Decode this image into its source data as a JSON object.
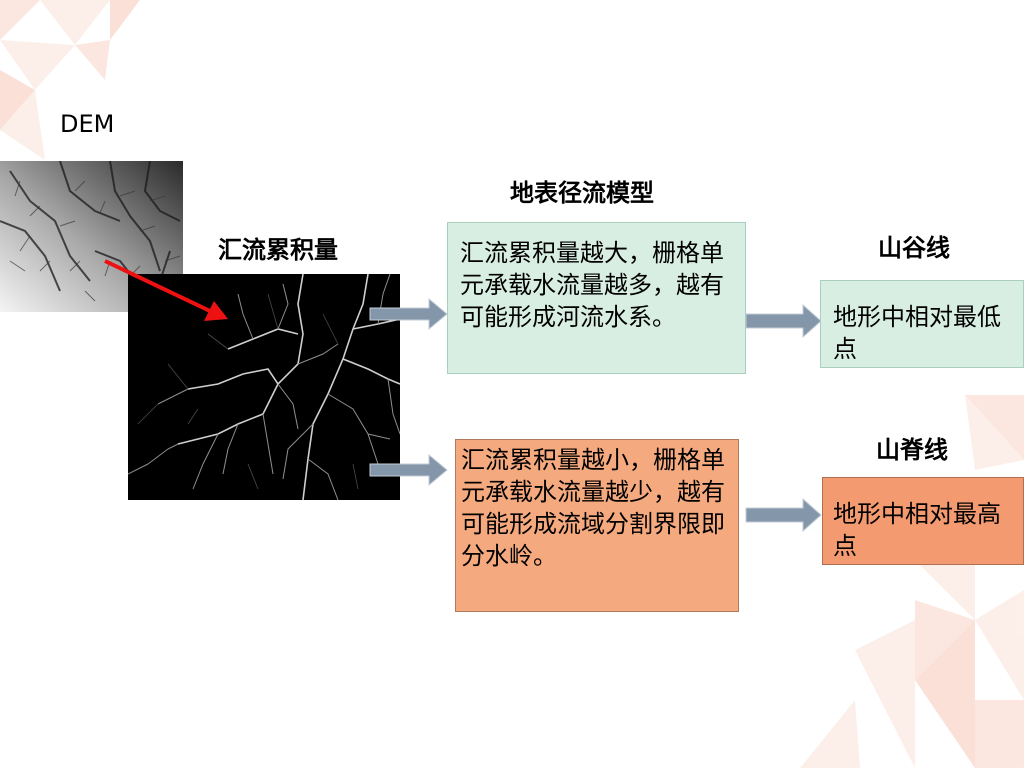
{
  "labels": {
    "dem": "DEM",
    "accumulation": "汇流累积量",
    "model": "地表径流模型",
    "valley": "山谷线",
    "ridge": "山脊线"
  },
  "boxes": {
    "large_accumulation": "汇流累积量越大，栅格单元承载水流量越多，越有可能形成河流水系。",
    "small_accumulation": "汇流累积量越小，栅格单元承载水流量越少，越有可能形成流域分割界限即分水岭。",
    "valley_def": "地形中相对最低点",
    "ridge_def": "地形中相对最高点"
  },
  "colors": {
    "green_box": "#d9eee3",
    "orange_box": "#f4a97e",
    "orange_box_dark": "#f49a70",
    "arrow_gray": "#8496a9",
    "red_arrow": "#ee1111",
    "decor_pink": "#f8d5c8"
  },
  "icons": {
    "dem_image": "dem-terrain-image",
    "accumulation_image": "flow-accumulation-image"
  }
}
